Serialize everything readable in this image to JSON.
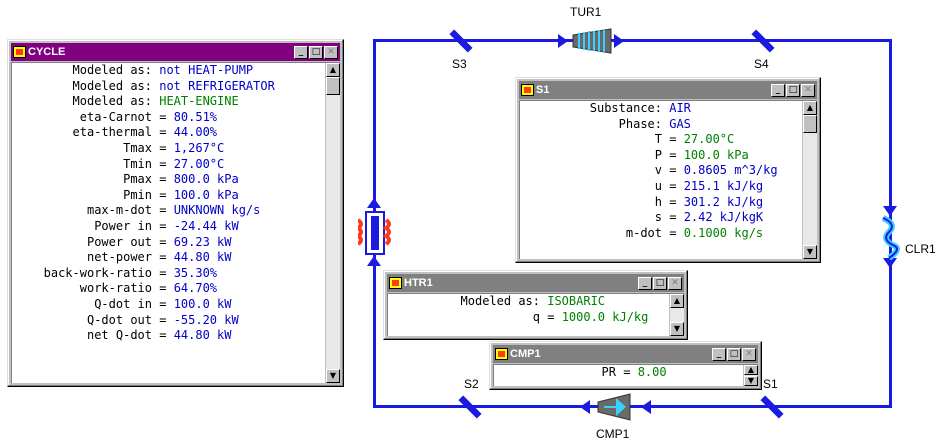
{
  "diagram": {
    "labels": {
      "tur1": "TUR1",
      "cmp1": "CMP1",
      "clr1": "CLR1",
      "s1": "S1",
      "s2": "S2",
      "s3": "S3",
      "s4": "S4"
    },
    "colors": {
      "flow": "#1a1ae0",
      "value": "#0000c8",
      "green": "#008000",
      "active_title": "#800080",
      "inactive_title": "#808080"
    }
  },
  "windows": {
    "cycle": {
      "title": "CYCLE",
      "rows": [
        {
          "key": "Modeled as:",
          "sep": " ",
          "value": "not HEAT-PUMP",
          "green": false
        },
        {
          "key": "Modeled as:",
          "sep": " ",
          "value": "not REFRIGERATOR",
          "green": false
        },
        {
          "key": "Modeled as:",
          "sep": " ",
          "value": "HEAT-ENGINE",
          "green": true
        },
        {
          "key": "eta-Carnot",
          "sep": " = ",
          "value": "80.51%",
          "green": false
        },
        {
          "key": "eta-thermal",
          "sep": " = ",
          "value": "44.00%",
          "green": false
        },
        {
          "key": "Tmax",
          "sep": " = ",
          "value": "1,267°C",
          "green": false
        },
        {
          "key": "Tmin",
          "sep": " = ",
          "value": "27.00°C",
          "green": false
        },
        {
          "key": "Pmax",
          "sep": " = ",
          "value": "800.0 kPa",
          "green": false
        },
        {
          "key": "Pmin",
          "sep": " = ",
          "value": "100.0 kPa",
          "green": false
        },
        {
          "key": "max-m-dot",
          "sep": " = ",
          "value": "UNKNOWN kg/s",
          "green": false
        },
        {
          "key": "Power in",
          "sep": " = ",
          "value": "-24.44 kW",
          "green": false
        },
        {
          "key": "Power out",
          "sep": " = ",
          "value": "69.23 kW",
          "green": false
        },
        {
          "key": "net-power",
          "sep": " = ",
          "value": "44.80 kW",
          "green": false
        },
        {
          "key": "back-work-ratio",
          "sep": " = ",
          "value": "35.30%",
          "green": false
        },
        {
          "key": "work-ratio",
          "sep": " = ",
          "value": "64.70%",
          "green": false
        },
        {
          "key": "Q-dot in",
          "sep": " = ",
          "value": "100.0 kW",
          "green": false
        },
        {
          "key": "Q-dot out",
          "sep": " = ",
          "value": "-55.20 kW",
          "green": false
        },
        {
          "key": "net Q-dot",
          "sep": " = ",
          "value": "44.80 kW",
          "green": false
        }
      ]
    },
    "s1": {
      "title": "S1",
      "rows": [
        {
          "key": "Substance:",
          "sep": " ",
          "value": "AIR",
          "green": false
        },
        {
          "key": "Phase:",
          "sep": " ",
          "value": "GAS",
          "green": false
        },
        {
          "key": "T",
          "sep": " = ",
          "value": "27.00°C",
          "green": true
        },
        {
          "key": "P",
          "sep": " = ",
          "value": "100.0 kPa",
          "green": true
        },
        {
          "key": "v",
          "sep": " = ",
          "value": "0.8605 m^3/kg",
          "green": false
        },
        {
          "key": "u",
          "sep": " = ",
          "value": "215.1 kJ/kg",
          "green": false
        },
        {
          "key": "h",
          "sep": " = ",
          "value": "301.2 kJ/kg",
          "green": false
        },
        {
          "key": "s",
          "sep": " = ",
          "value": "2.42 kJ/kgK",
          "green": false
        },
        {
          "key": "m-dot",
          "sep": " = ",
          "value": "0.1000 kg/s",
          "green": true
        }
      ]
    },
    "htr1": {
      "title": "HTR1",
      "rows": [
        {
          "key": "Modeled as:",
          "sep": " ",
          "value": "ISOBARIC",
          "green": true
        },
        {
          "key": "q",
          "sep": " = ",
          "value": "1000.0 kJ/kg",
          "green": true
        }
      ]
    },
    "cmp1": {
      "title": "CMP1",
      "rows": [
        {
          "key": "PR",
          "sep": " = ",
          "value": "8.00",
          "green": true
        }
      ]
    }
  },
  "icons": {
    "window": "window-app-icon",
    "minimize": "minimize-icon",
    "maximize": "maximize-icon",
    "close": "close-icon"
  }
}
